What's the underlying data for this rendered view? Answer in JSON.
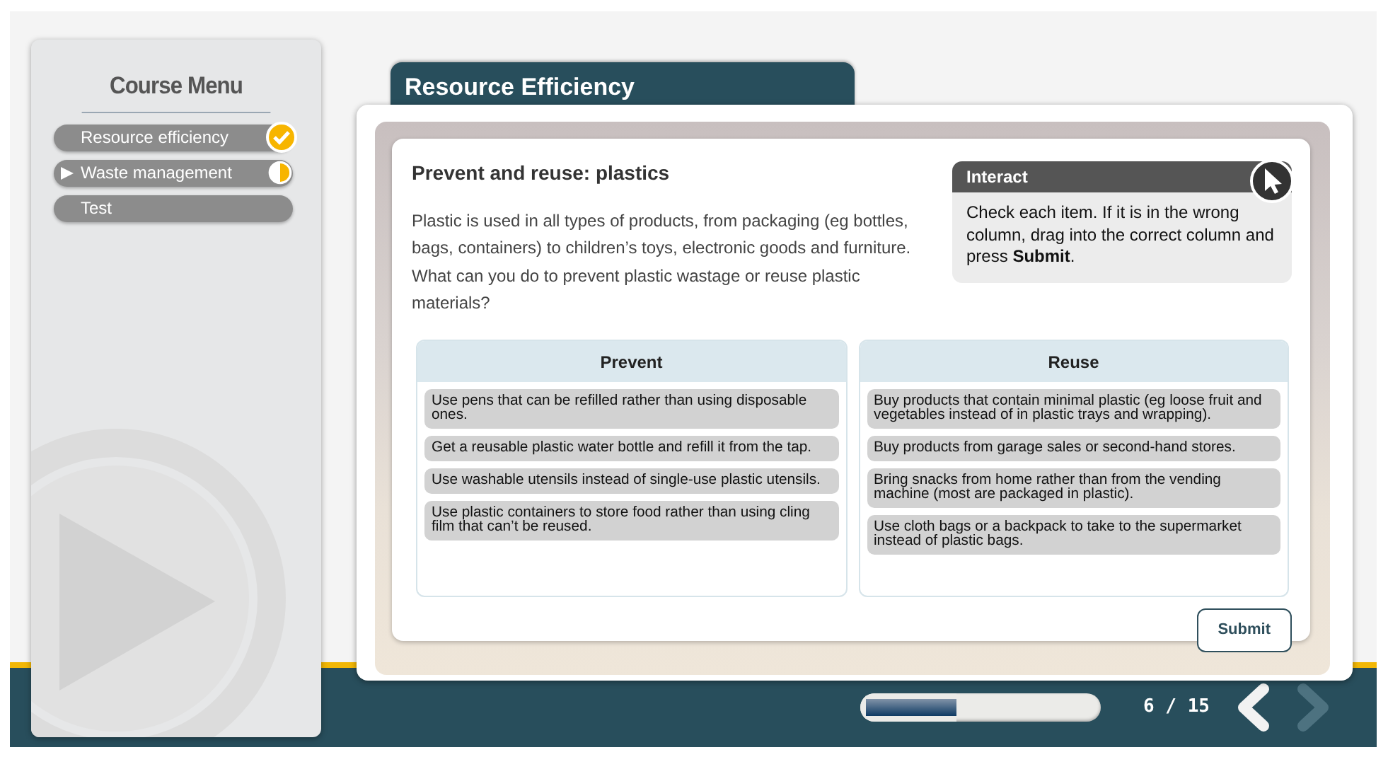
{
  "sidebar": {
    "title": "Course Menu",
    "items": [
      {
        "label": "Resource efficiency",
        "current": false,
        "kind": "complete"
      },
      {
        "label": "Waste management",
        "current": true,
        "kind": "partial"
      },
      {
        "label": "Test",
        "current": false,
        "kind": "none"
      }
    ]
  },
  "module_tab": {
    "title": "Resource Efficiency"
  },
  "content": {
    "heading": "Prevent and reuse: plastics",
    "body": "Plastic is used in all types of products, from packaging (eg bottles, bags, containers) to children’s toys, electronic goods and furniture. What can you do to prevent plastic wastage or reuse plastic materials?"
  },
  "interact": {
    "title": "Interact",
    "text": "Check each item. If it is in the wrong column, drag into the correct column and press **Submit**."
  },
  "columns": [
    {
      "title": "Prevent",
      "items": [
        "Use pens that can be refilled rather than using disposable ones.",
        "Get a reusable plastic water bottle and refill it from the tap.",
        "Use washable utensils instead of single-use plastic utensils.",
        "Use plastic containers to store food rather than using cling film that can’t be reused."
      ]
    },
    {
      "title": "Reuse",
      "items": [
        "Buy products that contain minimal plastic (eg loose fruit and vegetables instead of in plastic trays and wrapping).",
        "Buy products from garage sales or second-hand stores.",
        "Bring snacks from home rather than from the vending machine (most are packaged in plastic).",
        "Use cloth bags or a backpack to take to the supermarket instead of plastic bags."
      ]
    }
  ],
  "submit_button": {
    "label": "Submit"
  },
  "footer": {
    "progress": {
      "level": 0.4
    },
    "page_counter": "6 / 15",
    "prev_button": {
      "disabled": false
    },
    "next_button": {
      "disabled": true
    }
  }
}
